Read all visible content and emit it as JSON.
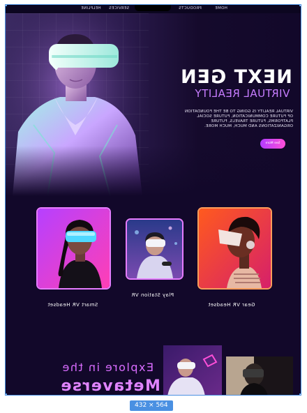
{
  "nav": {
    "links": [
      "HOME",
      "PRODUCTS",
      "SERVICES",
      "HELPLINE"
    ]
  },
  "hero": {
    "title": "NEXT GEN",
    "subtitle": "VIRTUAL REALITY",
    "description_lines": [
      "VIRTUAL REALITY IS GOING TO BE THE FOUNDATION",
      "OF FUTURE COMMUNICATION, FUTURE SOCIAL",
      "PLATFORMS, FUTURE TRAVELS, FUTURE",
      "ORGANIZATIONS AND MUCH, MUCH MORE."
    ],
    "cta_label": "See More"
  },
  "products": [
    {
      "label": "Smart VR Headset"
    },
    {
      "label": "Play Station VR"
    },
    {
      "label": "Gear VR Headset"
    }
  ],
  "explore": {
    "line1": "Explore in the",
    "line2": "Metaverse"
  },
  "selection": {
    "size_label": "432 × 564",
    "accent": "#4a90e2"
  },
  "colors": {
    "background": "#12082a",
    "accent_pink": "#ff4fd8",
    "accent_purple": "#c77dff",
    "card_border": "#e67cff"
  }
}
